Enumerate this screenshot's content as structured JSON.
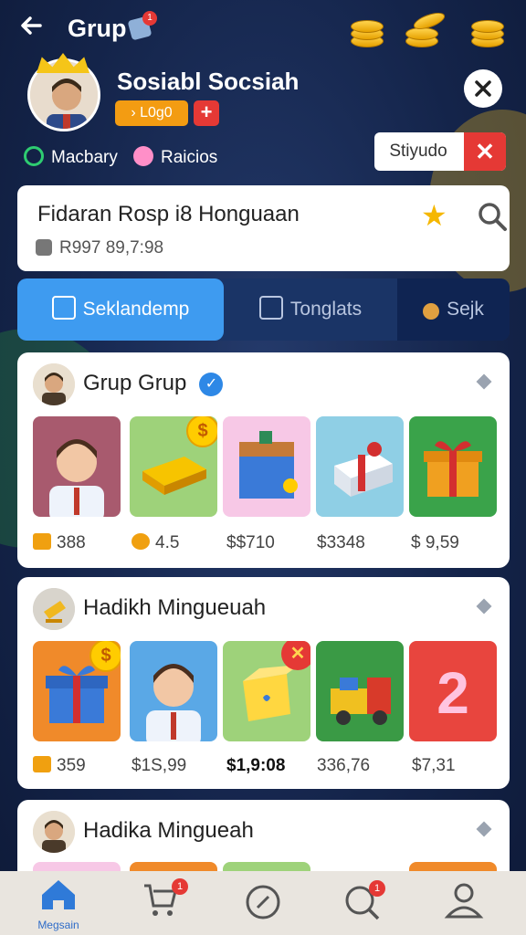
{
  "header": {
    "title": "Grup",
    "title_badge": "1",
    "back_icon": "arrow-left-icon",
    "coin_stacks": [
      "coin-stack-icon",
      "coin-stack-icon",
      "coin-stack-icon"
    ]
  },
  "profile": {
    "name": "Sosiabl Socsiah",
    "badge_label": "› L0g0",
    "plus_label": "+",
    "stats": [
      {
        "icon": "q-icon",
        "label": "Macbary",
        "color": "#2ecc71"
      },
      {
        "icon": "heart-icon",
        "label": "Raicios",
        "color": "#ff8fc8"
      }
    ],
    "studio_label": "Stiyudo",
    "studio_close": "✕"
  },
  "search_card": {
    "title": "Fidaran Rosp i8 Honguaan",
    "subtitle": "R997 89,7:98"
  },
  "tabs": [
    {
      "label": "Seklandemp",
      "active": true
    },
    {
      "label": "Tonglats",
      "active": false
    },
    {
      "label": "Sejk",
      "active": false
    }
  ],
  "groups": [
    {
      "title": "Grup Grup",
      "verified": true,
      "items": [
        {
          "kind": "person",
          "bg": "#a85a6e",
          "price": "388",
          "price_icon": true
        },
        {
          "kind": "gold",
          "bg": "#9ed27a",
          "price": "4.5",
          "price_icon": true,
          "corner": "$"
        },
        {
          "kind": "box",
          "bg": "#f7c8e6",
          "price": "$$710"
        },
        {
          "kind": "gift-white",
          "bg": "#8fcfe5",
          "price": "$3348"
        },
        {
          "kind": "gift-gold",
          "bg": "#3aa34a",
          "price": "$ 9,59"
        }
      ]
    },
    {
      "title": "Hadikh Mingueuah",
      "verified": false,
      "items": [
        {
          "kind": "gift-blue",
          "bg": "#f08a2a",
          "price": "359",
          "price_icon": true,
          "corner": "$"
        },
        {
          "kind": "person",
          "bg": "#5aa8e6",
          "price": "$1S,99"
        },
        {
          "kind": "yellow-box",
          "bg": "#9ed27a",
          "price": "$1,9:08",
          "bold": true,
          "corner_red": "✕"
        },
        {
          "kind": "truck",
          "bg": "#3a9a45",
          "price": "336,76"
        },
        {
          "kind": "number",
          "bg": "#e8453e",
          "price": "$7,31",
          "text": "2"
        }
      ]
    },
    {
      "title": "Hadika Minguеah",
      "verified": false,
      "items": []
    }
  ],
  "bottom_nav": [
    {
      "icon": "home-icon",
      "label": "Megsain"
    },
    {
      "icon": "cart-icon",
      "label": "",
      "badge": "1"
    },
    {
      "icon": "compass-icon",
      "label": ""
    },
    {
      "icon": "search-icon",
      "label": "",
      "badge": "1"
    },
    {
      "icon": "user-icon",
      "label": ""
    }
  ]
}
